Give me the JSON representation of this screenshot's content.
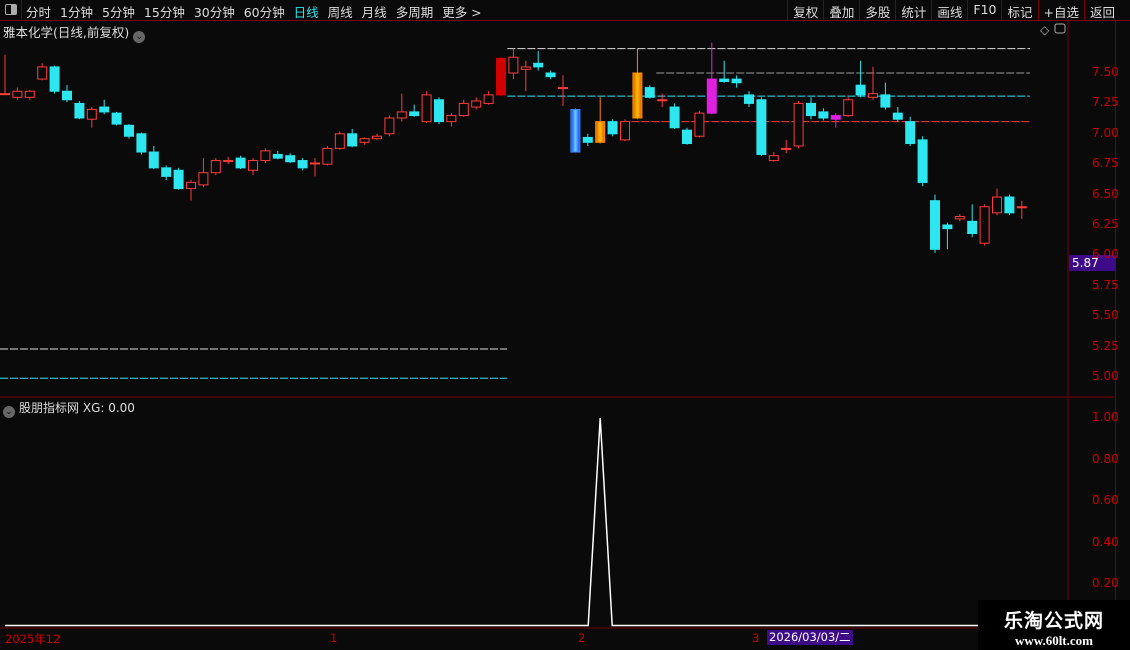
{
  "toolbar": {
    "periods": [
      "分时",
      "1分钟",
      "5分钟",
      "15分钟",
      "30分钟",
      "60分钟",
      "日线",
      "周线",
      "月线",
      "多周期",
      "更多 >"
    ],
    "active_period": "日线",
    "tools": [
      "复权",
      "叠加",
      "多股",
      "统计",
      "画线",
      "F10",
      "标记",
      "+自选",
      "返回"
    ]
  },
  "chart": {
    "title": "雅本化学(日线,前复权)",
    "price_ticks": [
      "7.50",
      "7.25",
      "7.00",
      "6.75",
      "6.50",
      "6.25",
      "6.00",
      "5.75",
      "5.50",
      "5.25",
      "5.00"
    ],
    "current_price_badge": "5.87",
    "colors": {
      "up": "#ff3b3b",
      "down": "#2ee6f0",
      "background": "#0a0a0a",
      "axis": "#cc0000",
      "badge": "#3d0b87"
    },
    "candles": [
      [
        7.33,
        7.65,
        7.32,
        7.33
      ],
      [
        7.3,
        7.38,
        7.28,
        7.35
      ],
      [
        7.3,
        7.36,
        7.28,
        7.35
      ],
      [
        7.45,
        7.58,
        7.44,
        7.55
      ],
      [
        7.55,
        7.56,
        7.33,
        7.35
      ],
      [
        7.35,
        7.4,
        7.26,
        7.28
      ],
      [
        7.25,
        7.27,
        7.12,
        7.13
      ],
      [
        7.12,
        7.22,
        7.05,
        7.2
      ],
      [
        7.22,
        7.28,
        7.16,
        7.18
      ],
      [
        7.17,
        7.18,
        7.07,
        7.08
      ],
      [
        7.07,
        7.08,
        6.96,
        6.98
      ],
      [
        7.0,
        7.01,
        6.83,
        6.85
      ],
      [
        6.85,
        6.9,
        6.71,
        6.72
      ],
      [
        6.72,
        6.74,
        6.62,
        6.65
      ],
      [
        6.7,
        6.72,
        6.54,
        6.55
      ],
      [
        6.55,
        6.62,
        6.45,
        6.6
      ],
      [
        6.58,
        6.8,
        6.56,
        6.68
      ],
      [
        6.68,
        6.8,
        6.66,
        6.78
      ],
      [
        6.78,
        6.81,
        6.75,
        6.78
      ],
      [
        6.8,
        6.82,
        6.71,
        6.72
      ],
      [
        6.7,
        6.8,
        6.66,
        6.78
      ],
      [
        6.78,
        6.88,
        6.76,
        6.86
      ],
      [
        6.83,
        6.86,
        6.79,
        6.8
      ],
      [
        6.82,
        6.84,
        6.76,
        6.77
      ],
      [
        6.78,
        6.8,
        6.7,
        6.72
      ],
      [
        6.76,
        6.8,
        6.65,
        6.76
      ],
      [
        6.75,
        6.9,
        6.74,
        6.88
      ],
      [
        6.88,
        7.02,
        6.87,
        7.0
      ],
      [
        7.0,
        7.04,
        6.89,
        6.9
      ],
      [
        6.93,
        6.97,
        6.91,
        6.96
      ],
      [
        6.96,
        7.0,
        6.95,
        6.98
      ],
      [
        7.0,
        7.15,
        6.98,
        7.13
      ],
      [
        7.13,
        7.33,
        7.1,
        7.18
      ],
      [
        7.18,
        7.24,
        7.14,
        7.15
      ],
      [
        7.1,
        7.35,
        7.09,
        7.32
      ],
      [
        7.28,
        7.3,
        7.08,
        7.1
      ],
      [
        7.1,
        7.17,
        7.06,
        7.15
      ],
      [
        7.15,
        7.28,
        7.14,
        7.25
      ],
      [
        7.22,
        7.3,
        7.2,
        7.27
      ],
      [
        7.25,
        7.35,
        7.24,
        7.32
      ],
      [
        7.32,
        7.63,
        7.31,
        7.62
      ],
      [
        7.5,
        7.7,
        7.45,
        7.63
      ],
      [
        7.53,
        7.6,
        7.35,
        7.55
      ],
      [
        7.58,
        7.68,
        7.52,
        7.55
      ],
      [
        7.5,
        7.52,
        7.45,
        7.47
      ],
      [
        7.38,
        7.48,
        7.23,
        7.38
      ],
      [
        7.2,
        7.21,
        6.85,
        6.85
      ],
      [
        6.97,
        7.0,
        6.9,
        6.93
      ],
      [
        7.1,
        7.3,
        6.92,
        6.93
      ],
      [
        7.1,
        7.12,
        6.98,
        7.0
      ],
      [
        6.95,
        7.12,
        6.94,
        7.1
      ],
      [
        7.5,
        7.7,
        7.12,
        7.13
      ],
      [
        7.38,
        7.4,
        7.29,
        7.3
      ],
      [
        7.28,
        7.33,
        7.22,
        7.28
      ],
      [
        7.22,
        7.25,
        7.04,
        7.05
      ],
      [
        7.03,
        7.05,
        6.91,
        6.92
      ],
      [
        6.98,
        7.19,
        6.97,
        7.17
      ],
      [
        7.17,
        7.75,
        7.16,
        7.45
      ],
      [
        7.45,
        7.6,
        7.42,
        7.43
      ],
      [
        7.45,
        7.48,
        7.38,
        7.42
      ],
      [
        7.32,
        7.35,
        7.22,
        7.25
      ],
      [
        7.28,
        7.3,
        6.82,
        6.83
      ],
      [
        6.78,
        6.85,
        6.77,
        6.82
      ],
      [
        6.88,
        6.95,
        6.84,
        6.88
      ],
      [
        6.9,
        7.27,
        6.88,
        7.25
      ],
      [
        7.25,
        7.3,
        7.12,
        7.15
      ],
      [
        7.18,
        7.21,
        7.11,
        7.13
      ],
      [
        7.15,
        7.17,
        7.05,
        7.12
      ],
      [
        7.15,
        7.3,
        7.14,
        7.28
      ],
      [
        7.4,
        7.6,
        7.3,
        7.32
      ],
      [
        7.3,
        7.55,
        7.28,
        7.33
      ],
      [
        7.32,
        7.42,
        7.2,
        7.22
      ],
      [
        7.17,
        7.22,
        7.1,
        7.12
      ],
      [
        7.1,
        7.14,
        6.9,
        6.92
      ],
      [
        6.95,
        6.98,
        6.57,
        6.6
      ],
      [
        6.45,
        6.5,
        6.02,
        6.05
      ],
      [
        6.25,
        6.27,
        6.05,
        6.22
      ],
      [
        6.3,
        6.34,
        6.28,
        6.32
      ],
      [
        6.28,
        6.42,
        6.15,
        6.18
      ],
      [
        6.1,
        6.42,
        6.08,
        6.4
      ],
      [
        6.35,
        6.55,
        6.33,
        6.48
      ],
      [
        6.48,
        6.5,
        6.33,
        6.35
      ],
      [
        6.4,
        6.45,
        6.3,
        6.4
      ]
    ],
    "special_candle_colors": {
      "46": "blue-gradient",
      "48": "orange-gradient",
      "51": "orange-gradient",
      "57": "#e020e0",
      "67": "#e020e0",
      "40": "#d00000"
    },
    "levels": [
      {
        "price": 7.7,
        "color": "#dddddd",
        "from_index": 41
      },
      {
        "price": 7.5,
        "color": "#999999",
        "from_index": 53
      },
      {
        "price": 7.31,
        "color": "#2ee6f0",
        "from_index": 41
      },
      {
        "price": 7.1,
        "color": "#ff3b3b",
        "from_index": 51
      },
      {
        "price": 5.23,
        "color": "#dddddd",
        "to_index": 40
      },
      {
        "price": 4.99,
        "color": "#2ee6f0",
        "to_index": 40
      }
    ]
  },
  "indicator": {
    "title": "股朋指标网",
    "value_label": "XG: 0.00",
    "ticks": [
      "1.00",
      "0.80",
      "0.60",
      "0.40",
      "0.20"
    ],
    "signal_index": 48,
    "signal_value": 1
  },
  "xaxis": {
    "labels": [
      "2025年12",
      "1",
      "2",
      "3"
    ],
    "cursor_date": "2026/03/03/二"
  },
  "watermark": {
    "name": "乐淘公式网",
    "url": "www.60lt.com"
  }
}
